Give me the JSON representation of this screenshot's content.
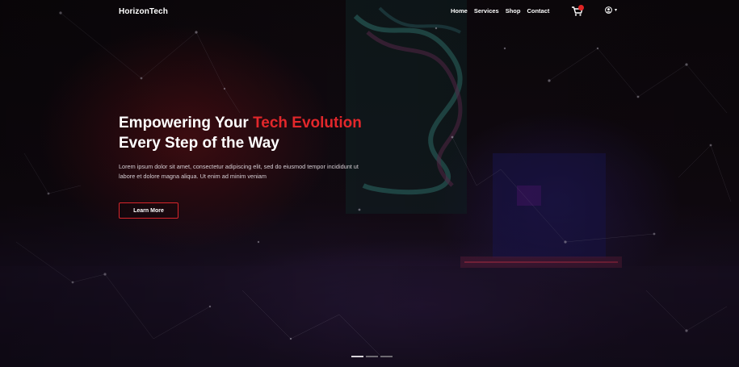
{
  "nav": {
    "brand": "HorizonTech",
    "links": [
      "Home",
      "Services",
      "Shop",
      "Contact"
    ],
    "cart_icon": "cart-icon",
    "user_icon": "user-circle-icon",
    "caret": "▾"
  },
  "hero": {
    "headline_part1": "Empowering Your ",
    "headline_accent": "Tech Evolution",
    "headline_line2": "Every Step of the Way",
    "description": "Lorem ipsum dolor sit amet, consectetur adipiscing elit, sed do eiusmod tempor incididunt ut labore et dolore magna aliqua. Ut enim ad minim veniam",
    "cta_label": "Learn More"
  },
  "slider": {
    "count": 3,
    "active": 1
  },
  "colors": {
    "accent": "#e3272b",
    "background": "#0b0710"
  }
}
